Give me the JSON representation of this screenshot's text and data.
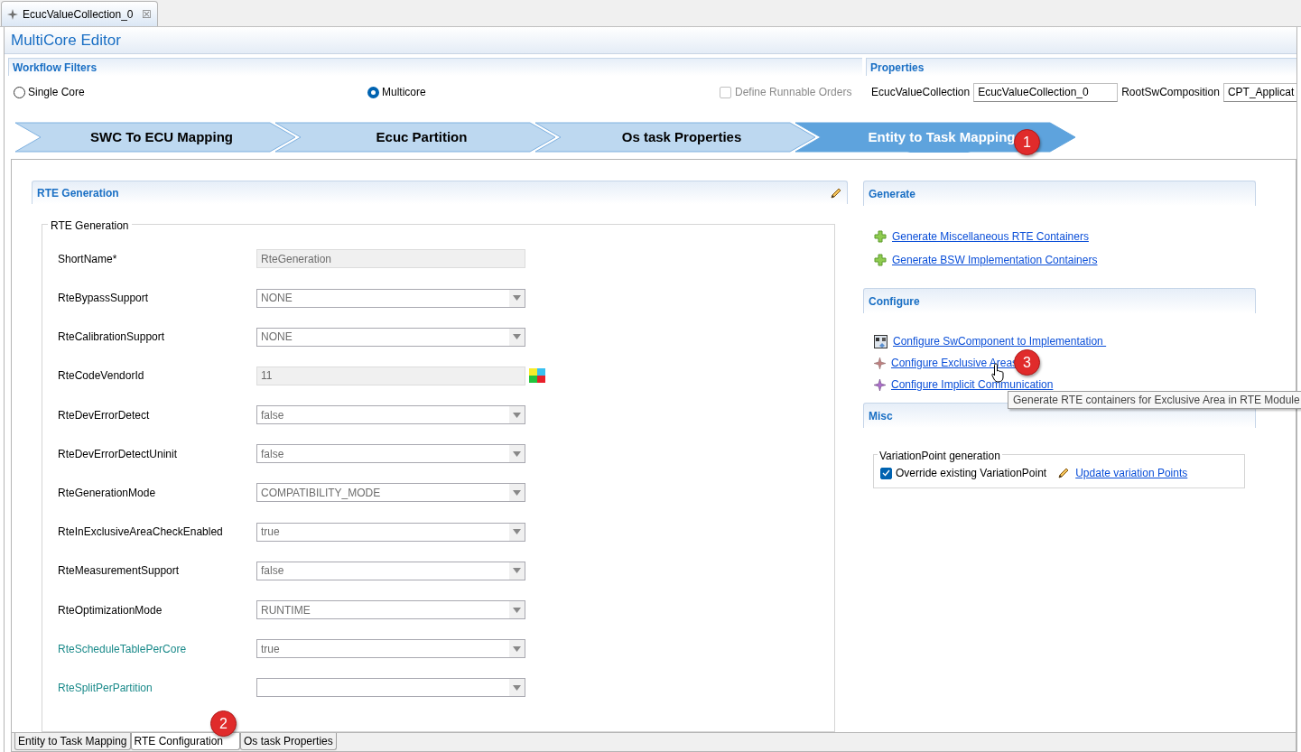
{
  "editor_tab": {
    "label": "EcucValueCollection_0",
    "close": "☒"
  },
  "editor": {
    "title": "MultiCore Editor"
  },
  "workflow_filters": {
    "title": "Workflow Filters",
    "radios": [
      {
        "label": "Single Core",
        "selected": false
      },
      {
        "label": "Multicore",
        "selected": true
      }
    ],
    "checkbox": {
      "label": "Define Runnable Orders",
      "checked": false,
      "disabled": true
    }
  },
  "properties": {
    "title": "Properties",
    "fields": [
      {
        "label": "EcucValueCollection",
        "value": "EcucValueCollection_0"
      },
      {
        "label": "RootSwComposition",
        "value": "CPT_Applicat"
      }
    ]
  },
  "workflow_steps": [
    {
      "label": "SWC To ECU Mapping",
      "selected": false
    },
    {
      "label": "Ecuc Partition",
      "selected": false
    },
    {
      "label": "Os task Properties",
      "selected": false
    },
    {
      "label": "Entity to Task Mapping",
      "selected": true
    }
  ],
  "rte_generation": {
    "title": "RTE Generation",
    "group": "RTE Generation",
    "rows": [
      {
        "label": "ShortName*",
        "kind": "text",
        "value": "RteGeneration",
        "color": "#000000",
        "format_button": false
      },
      {
        "label": "RteBypassSupport",
        "kind": "combo",
        "value": "NONE",
        "color": "#000000",
        "format_button": false
      },
      {
        "label": "RteCalibrationSupport",
        "kind": "combo",
        "value": "NONE",
        "color": "#000000",
        "format_button": false
      },
      {
        "label": "RteCodeVendorId",
        "kind": "text",
        "value": "11",
        "color": "#000000",
        "format_button": true
      },
      {
        "label": "RteDevErrorDetect",
        "kind": "combo",
        "value": "false",
        "color": "#000000",
        "format_button": false
      },
      {
        "label": "RteDevErrorDetectUninit",
        "kind": "combo",
        "value": "false",
        "color": "#000000",
        "format_button": false
      },
      {
        "label": "RteGenerationMode",
        "kind": "combo",
        "value": "COMPATIBILITY_MODE",
        "color": "#000000",
        "format_button": false
      },
      {
        "label": "RteInExclusiveAreaCheckEnabled",
        "kind": "combo",
        "value": "true",
        "color": "#000000",
        "format_button": false
      },
      {
        "label": "RteMeasurementSupport",
        "kind": "combo",
        "value": "false",
        "color": "#000000",
        "format_button": false
      },
      {
        "label": "RteOptimizationMode",
        "kind": "combo",
        "value": "RUNTIME",
        "color": "#000000",
        "format_button": false
      },
      {
        "label": "RteScheduleTablePerCore",
        "kind": "combo",
        "value": "true",
        "color": "#1a8a8a",
        "format_button": false
      },
      {
        "label": "RteSplitPerPartition",
        "kind": "combo",
        "value": "",
        "color": "#1a8a8a",
        "format_button": false
      }
    ]
  },
  "generate": {
    "title": "Generate",
    "links": [
      {
        "label": "Generate Miscellaneous RTE Containers"
      },
      {
        "label": "Generate BSW Implementation Containers"
      }
    ]
  },
  "configure": {
    "title": "Configure",
    "links": [
      {
        "label": "Configure SwComponent to Implementation ",
        "kind": "component"
      },
      {
        "label": "Configure Exclusive Areas",
        "kind": "area"
      },
      {
        "label": "Configure Implicit Communication",
        "kind": "communication"
      }
    ]
  },
  "tooltip": "Generate RTE containers for Exclusive Area in RTE Module",
  "misc": {
    "title": "Misc",
    "group": "VariationPoint generation",
    "checkbox": {
      "label": "Override existing VariationPoint",
      "checked": true
    },
    "link": "Update variation Points"
  },
  "bottom_tabs": [
    {
      "label": "Entity to Task Mapping",
      "selected": false
    },
    {
      "label": "RTE Configuration",
      "selected": true
    },
    {
      "label": "Os task Properties",
      "selected": false
    }
  ],
  "callouts": [
    "1",
    "2",
    "3"
  ]
}
